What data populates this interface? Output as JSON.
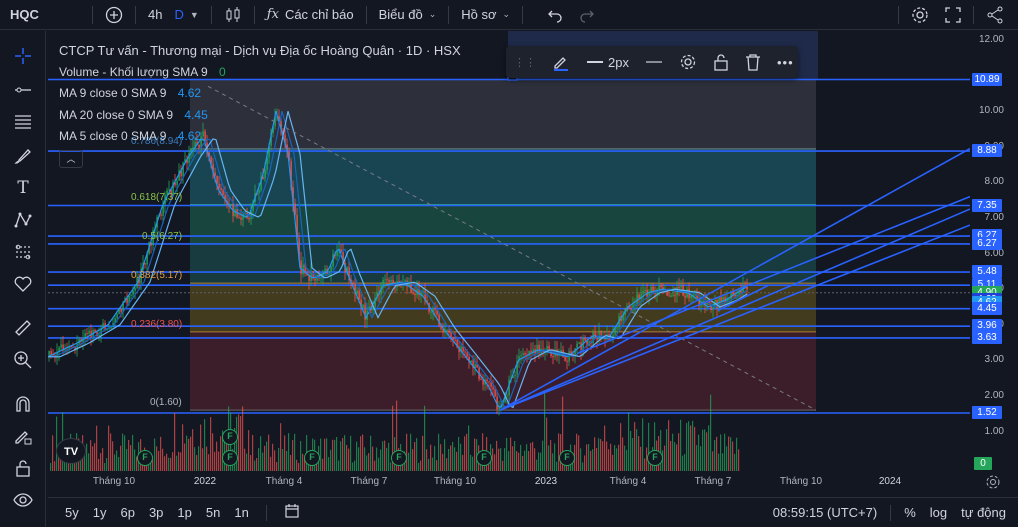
{
  "topbar": {
    "symbol": "HQC",
    "interval": "4h",
    "interval_suffix": "D",
    "indicators": "Các chỉ báo",
    "chart_type": "Biểu đồ",
    "profile": "Hồ sơ"
  },
  "legend": {
    "title": "CTCP Tư vấn - Thương mại - Dịch vụ Địa ốc Hoàng Quân · 1D · HSX",
    "volume_label": "Volume - Khối lượng SMA 9",
    "volume_value": "0",
    "ma9_label": "MA 9 close 0 SMA 9",
    "ma9_value": "4.62",
    "ma20_label": "MA 20 close 0 SMA 9",
    "ma20_value": "4.45",
    "ma5_label": "MA 5 close 0 SMA 9",
    "ma5_value": "4.62"
  },
  "draw_toolbar": {
    "width_label": "2px"
  },
  "fib_labels": [
    {
      "text": "0.618(7.37)",
      "price": 7.37
    },
    {
      "text": "0.5(6.27)",
      "price": 6.27
    },
    {
      "text": "0.382(5.17)",
      "price": 5.17
    },
    {
      "text": "0.236(3.80)",
      "price": 3.8
    },
    {
      "text": "0(1.60)",
      "price": 1.6
    },
    {
      "text": "0.786(8.94)",
      "price": 8.94
    }
  ],
  "y_axis": {
    "ticks": [
      "12.00",
      "10.00",
      "9.00",
      "8.00",
      "7.00",
      "6.00",
      "5.00",
      "4.00",
      "3.00",
      "2.00",
      "1.00"
    ],
    "tick_values": [
      12,
      10,
      9,
      8,
      7,
      6,
      5,
      4,
      3,
      2,
      1
    ]
  },
  "price_badges": [
    {
      "text": "10.89",
      "price": 10.89,
      "color": "#2962ff"
    },
    {
      "text": "8.88",
      "price": 8.88,
      "color": "#2962ff"
    },
    {
      "text": "7.35",
      "price": 7.35,
      "color": "#2962ff"
    },
    {
      "text": "6.27",
      "price": 6.49,
      "color": "#2962ff"
    },
    {
      "text": "6.27",
      "price": 6.27,
      "color": "#2962ff"
    },
    {
      "text": "5.48",
      "price": 5.48,
      "color": "#2962ff"
    },
    {
      "text": "5.11",
      "price": 5.11,
      "color": "#2962ff"
    },
    {
      "text": "4.90",
      "price": 4.9,
      "color": "#26a65b"
    },
    {
      "text": "4.69",
      "price": 4.69,
      "color": "#1e3fd8"
    },
    {
      "text": "4.62",
      "price": 4.62,
      "color": "#2196f3"
    },
    {
      "text": "4.45",
      "price": 4.45,
      "color": "#2962ff"
    },
    {
      "text": "3.96",
      "price": 3.96,
      "color": "#2962ff"
    },
    {
      "text": "3.63",
      "price": 3.63,
      "color": "#2962ff"
    },
    {
      "text": "1.52",
      "price": 1.52,
      "color": "#2962ff"
    },
    {
      "text": "0",
      "price": 0,
      "color": "#26a65b"
    }
  ],
  "x_axis": {
    "labels": [
      "Tháng 10",
      "2022",
      "Tháng 4",
      "Tháng 7",
      "Tháng 10",
      "2023",
      "Tháng 4",
      "Tháng 7",
      "Tháng 10",
      "2024"
    ]
  },
  "bottombar": {
    "ranges": [
      "5y",
      "1y",
      "6p",
      "3p",
      "1p",
      "5n",
      "1n"
    ],
    "clock": "08:59:15 (UTC+7)",
    "percent": "%",
    "log": "log",
    "auto": "tự động"
  },
  "colors": {
    "up": "#26a65b",
    "down": "#ef5350",
    "line_blue": "#2962ff",
    "ma": "#2196f3"
  },
  "icons": [
    "plus-circle-icon",
    "candles-icon",
    "fx-icon",
    "undo-icon",
    "redo-icon",
    "settings-icon",
    "fullscreen-icon",
    "share-icon",
    "pencil-icon",
    "line-width-icon",
    "gear-icon",
    "unlock-icon",
    "trash-icon",
    "more-icon",
    "crosshair-icon",
    "trend-line-icon",
    "fib-icon",
    "brush-icon",
    "text-icon",
    "pattern-icon",
    "prediction-icon",
    "heart-icon",
    "ruler-icon",
    "zoom-icon",
    "magnet-icon",
    "pencil-lock-icon",
    "lock-icon",
    "eye-icon",
    "calendar-icon"
  ]
}
